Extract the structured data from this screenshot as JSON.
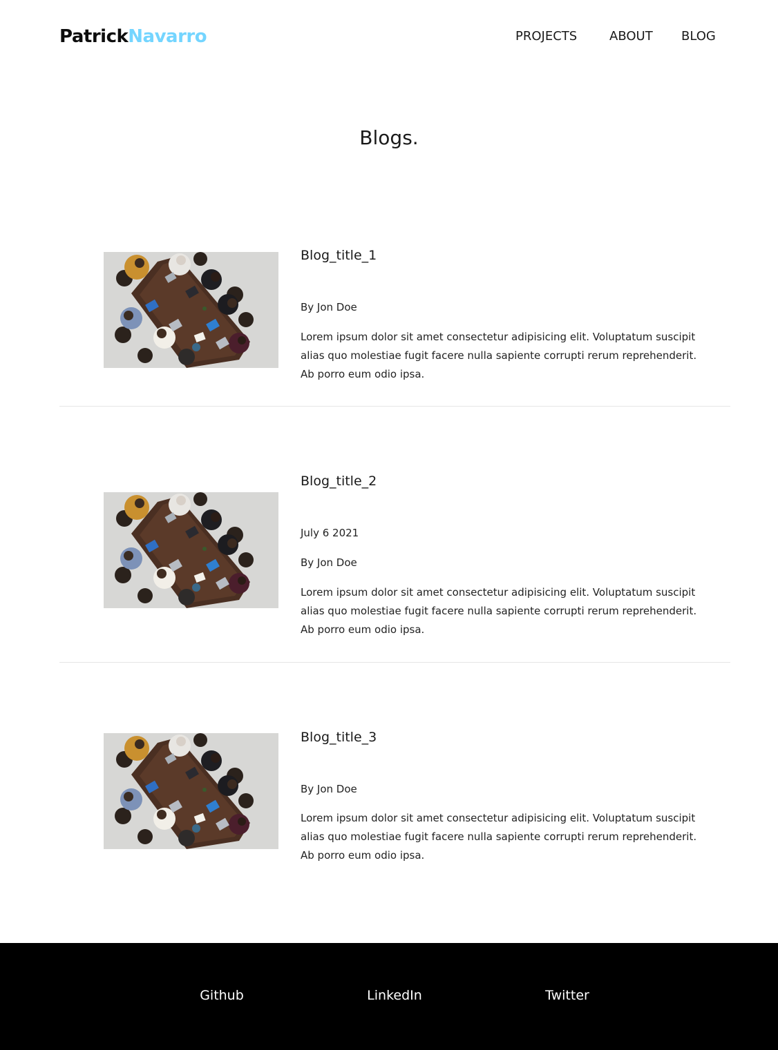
{
  "header": {
    "logo_first": "Patrick",
    "logo_last": "Navarro",
    "nav": [
      "PROJECTS",
      "ABOUT",
      "BLOG"
    ]
  },
  "page_title": "Blogs.",
  "posts": [
    {
      "title": "Blog_title_1",
      "date": "",
      "author": "By Jon Doe",
      "excerpt": "Lorem ipsum dolor sit amet consectetur adipisicing elit. Voluptatum suscipit alias quo molestiae fugit facere nulla sapiente corrupti rerum reprehenderit. Ab porro eum odio ipsa."
    },
    {
      "title": "Blog_title_2",
      "date": "July 6 2021",
      "author": "By Jon Doe",
      "excerpt": "Lorem ipsum dolor sit amet consectetur adipisicing elit. Voluptatum suscipit alias quo molestiae fugit facere nulla sapiente corrupti rerum reprehenderit. Ab porro eum odio ipsa."
    },
    {
      "title": "Blog_title_3",
      "date": "",
      "author": "By Jon Doe",
      "excerpt": "Lorem ipsum dolor sit amet consectetur adipisicing elit. Voluptatum suscipit alias quo molestiae fugit facere nulla sapiente corrupti rerum reprehenderit. Ab porro eum odio ipsa."
    }
  ],
  "footer": {
    "links": [
      "Github",
      "LinkedIn",
      "Twitter"
    ]
  },
  "colors": {
    "accent": "#74d5ff",
    "footer_bg": "#000000",
    "text": "#111111"
  }
}
